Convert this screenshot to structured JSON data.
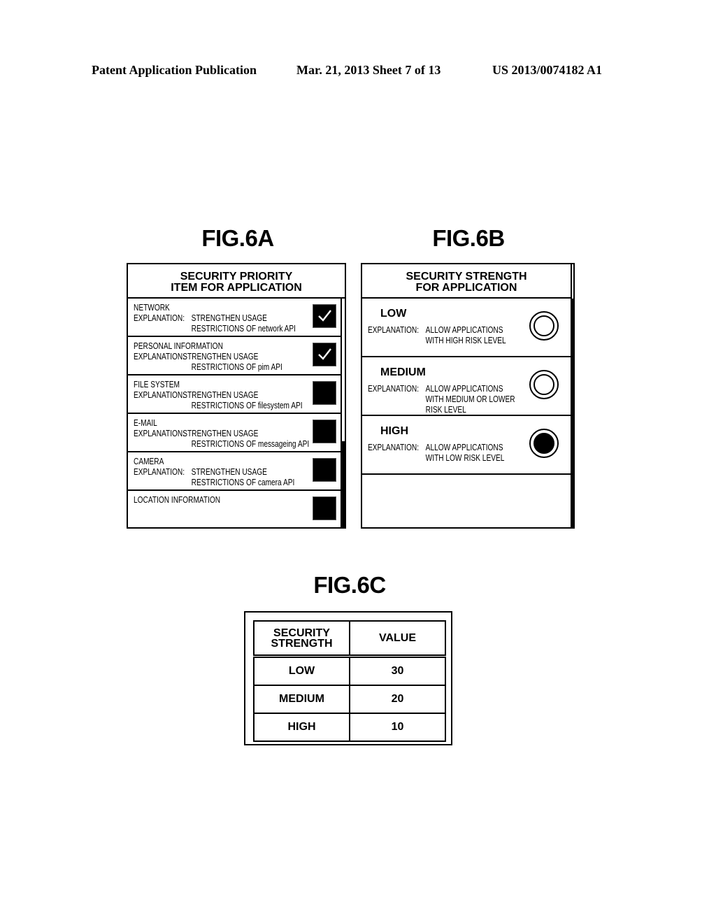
{
  "header": {
    "publication": "Patent Application Publication",
    "date_sheet": "Mar. 21, 2013  Sheet 7 of 13",
    "number": "US 2013/0074182 A1"
  },
  "fig6a": {
    "title": "FIG.6A",
    "panel_title_line1": "SECURITY PRIORITY",
    "panel_title_line2": "ITEM FOR APPLICATION",
    "scroll_position": "bottom",
    "items": [
      {
        "name": "NETWORK",
        "expl_label": "EXPLANATION:",
        "expl_line1": "STRENGTHEN USAGE",
        "expl_line2": "RESTRICTIONS OF network API",
        "checked": true
      },
      {
        "name": "PERSONAL INFORMATION",
        "expl_label": "EXPLANATION:",
        "expl_line1": "STRENGTHEN USAGE",
        "expl_line2": "RESTRICTIONS OF pim API",
        "checked": true
      },
      {
        "name": "FILE SYSTEM",
        "expl_label": "EXPLANATION:",
        "expl_line1": "STRENGTHEN USAGE",
        "expl_line2": "RESTRICTIONS OF filesystem API",
        "checked": false
      },
      {
        "name": "E-MAIL",
        "expl_label": "EXPLANATION:",
        "expl_line1": "STRENGTHEN USAGE",
        "expl_line2": "RESTRICTIONS OF messageing API",
        "checked": false
      },
      {
        "name": "CAMERA",
        "expl_label": "EXPLANATION:",
        "expl_line1": "STRENGTHEN USAGE",
        "expl_line2": "RESTRICTIONS OF camera API",
        "checked": false
      },
      {
        "name": "LOCATION INFORMATION",
        "checked": false
      }
    ]
  },
  "fig6b": {
    "title": "FIG.6B",
    "panel_title_line1": "SECURITY STRENGTH",
    "panel_title_line2": "FOR APPLICATION",
    "selected": "HIGH",
    "options": [
      {
        "level": "LOW",
        "expl_label": "EXPLANATION:",
        "lines": [
          "ALLOW APPLICATIONS",
          "WITH HIGH RISK LEVEL"
        ]
      },
      {
        "level": "MEDIUM",
        "expl_label": "EXPLANATION:",
        "lines": [
          "ALLOW APPLICATIONS",
          "WITH MEDIUM OR LOWER",
          "RISK LEVEL"
        ]
      },
      {
        "level": "HIGH",
        "expl_label": "EXPLANATION:",
        "lines": [
          "ALLOW APPLICATIONS",
          "WITH LOW RISK LEVEL"
        ]
      }
    ]
  },
  "fig6c": {
    "title": "FIG.6C",
    "headers": [
      "SECURITY STRENGTH",
      "VALUE"
    ],
    "header_line1": "SECURITY",
    "header_line2": "STRENGTH",
    "rows": [
      {
        "strength": "LOW",
        "value": "30"
      },
      {
        "strength": "MEDIUM",
        "value": "20"
      },
      {
        "strength": "HIGH",
        "value": "10"
      }
    ]
  }
}
